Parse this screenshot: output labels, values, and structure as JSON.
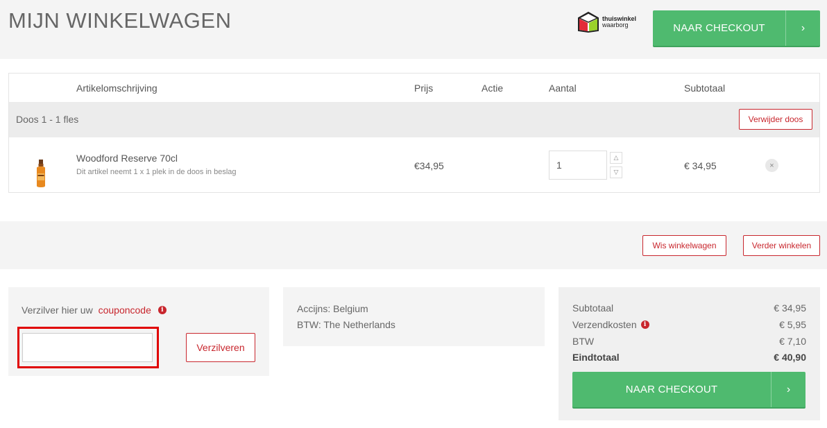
{
  "header": {
    "title": "MIJN WINKELWAGEN",
    "logo_line1": "thuiswinkel",
    "logo_line2": "waarborg",
    "checkout_label": "NAAR CHECKOUT",
    "checkout_arrow": "›"
  },
  "table": {
    "headers": {
      "description": "Artikelomschrijving",
      "price": "Prijs",
      "action": "Actie",
      "quantity": "Aantal",
      "subtotal": "Subtotaal"
    },
    "box": {
      "label": "Doos 1  - 1 fles",
      "remove_label": "Verwijder doos"
    },
    "item": {
      "name": "Woodford Reserve 70cl",
      "note": "Dit artikel neemt 1 x 1 plek in de doos in beslag",
      "price": "€34,95",
      "quantity": "1",
      "subtotal": "€ 34,95",
      "delete_symbol": "×"
    }
  },
  "actions": {
    "clear_label": "Wis winkelwagen",
    "continue_label": "Verder winkelen"
  },
  "coupon": {
    "text_prefix": "Verzilver hier uw ",
    "link_text": "couponcode",
    "info_symbol": "i",
    "input_value": "",
    "redeem_label": "Verzilveren"
  },
  "tax": {
    "excise": "Accijns: Belgium",
    "vat": "BTW: The Netherlands"
  },
  "totals": {
    "subtotal_label": "Subtotaal",
    "subtotal_value": "€ 34,95",
    "shipping_label": "Verzendkosten",
    "shipping_value": "€ 5,95",
    "vat_label": "BTW",
    "vat_value": "€ 7,10",
    "total_label": "Eindtotaal",
    "total_value": "€ 40,90",
    "checkout_label": "NAAR CHECKOUT",
    "checkout_arrow": "›"
  },
  "colors": {
    "accent_red": "#c8262d",
    "checkout_green": "#4fba6f",
    "panel_gray": "#f4f4f4"
  }
}
